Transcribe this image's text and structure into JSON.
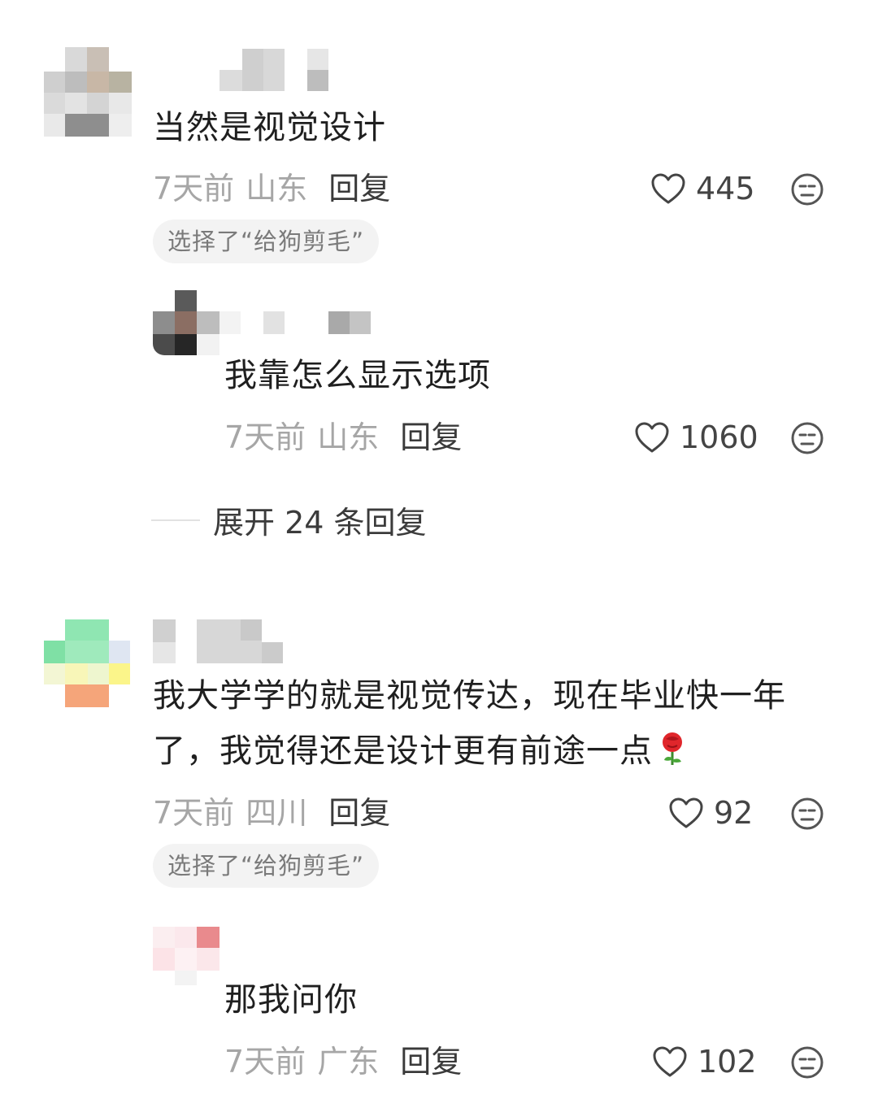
{
  "comments": [
    {
      "text": "当然是视觉设计",
      "time": "7天前",
      "location": "山东",
      "reply_label": "回复",
      "likes": "445",
      "choice": "选择了“给狗剪毛”",
      "replies": [
        {
          "text": "我靠怎么显示选项",
          "time": "7天前",
          "location": "山东",
          "reply_label": "回复",
          "likes": "1060"
        }
      ],
      "expand_label": "展开 24 条回复"
    },
    {
      "text_line1": "我大学学的就是视觉传达，现在毕业快一年",
      "text_line2": "了，我觉得还是设计更有前途一点",
      "time": "7天前",
      "location": "四川",
      "reply_label": "回复",
      "likes": "92",
      "choice": "选择了“给狗剪毛”",
      "replies": [
        {
          "text": "那我问你",
          "time": "7天前",
          "location": "广东",
          "reply_label": "回复",
          "likes": "102"
        }
      ]
    }
  ],
  "icons": {
    "like": "heart-outline-icon",
    "reaction": "speechless-face-icon",
    "emoji": "rose-icon"
  },
  "colors": {
    "text": "#1f1f1f",
    "meta": "#a6a6a6",
    "chip_bg": "#f3f3f3"
  }
}
